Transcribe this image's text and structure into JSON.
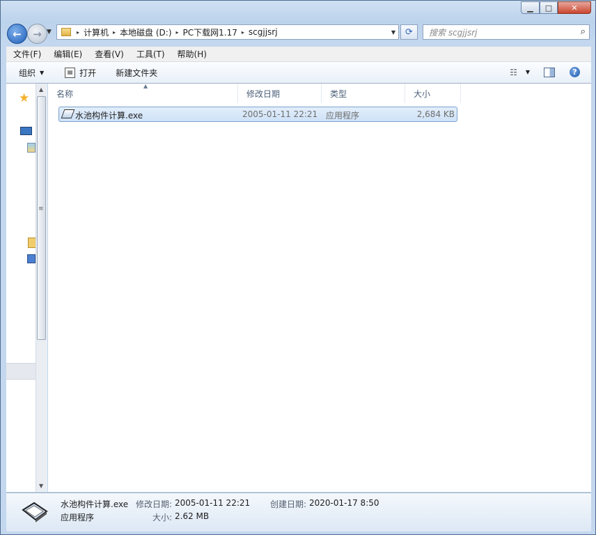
{
  "window": {
    "controls": {
      "minimize": "▁",
      "maximize": "□",
      "close": "✕"
    }
  },
  "address": {
    "crumbs": [
      "计算机",
      "本地磁盘 (D:)",
      "PC下载网1.17",
      "scgjjsrj"
    ],
    "separator": "▸"
  },
  "search": {
    "placeholder": "搜索 scgjjsrj"
  },
  "menubar": {
    "items": [
      "文件(F)",
      "编辑(E)",
      "查看(V)",
      "工具(T)",
      "帮助(H)"
    ]
  },
  "toolbar": {
    "organize": "组织",
    "open": "打开",
    "new_folder": "新建文件夹"
  },
  "columns": {
    "name": "名称",
    "modified": "修改日期",
    "type": "类型",
    "size": "大小"
  },
  "files": [
    {
      "name": "水池构件计算.exe",
      "modified": "2005-01-11 22:21",
      "type": "应用程序",
      "size": "2,684 KB"
    }
  ],
  "details": {
    "file_name": "水池构件计算.exe",
    "file_type": "应用程序",
    "modified_label": "修改日期:",
    "modified_value": "2005-01-11 22:21",
    "created_label": "创建日期:",
    "created_value": "2020-01-17 8:50",
    "size_label": "大小:",
    "size_value": "2.62 MB"
  },
  "colors": {
    "selection": "#cfe2f7",
    "accent": "#1f5fb8"
  }
}
